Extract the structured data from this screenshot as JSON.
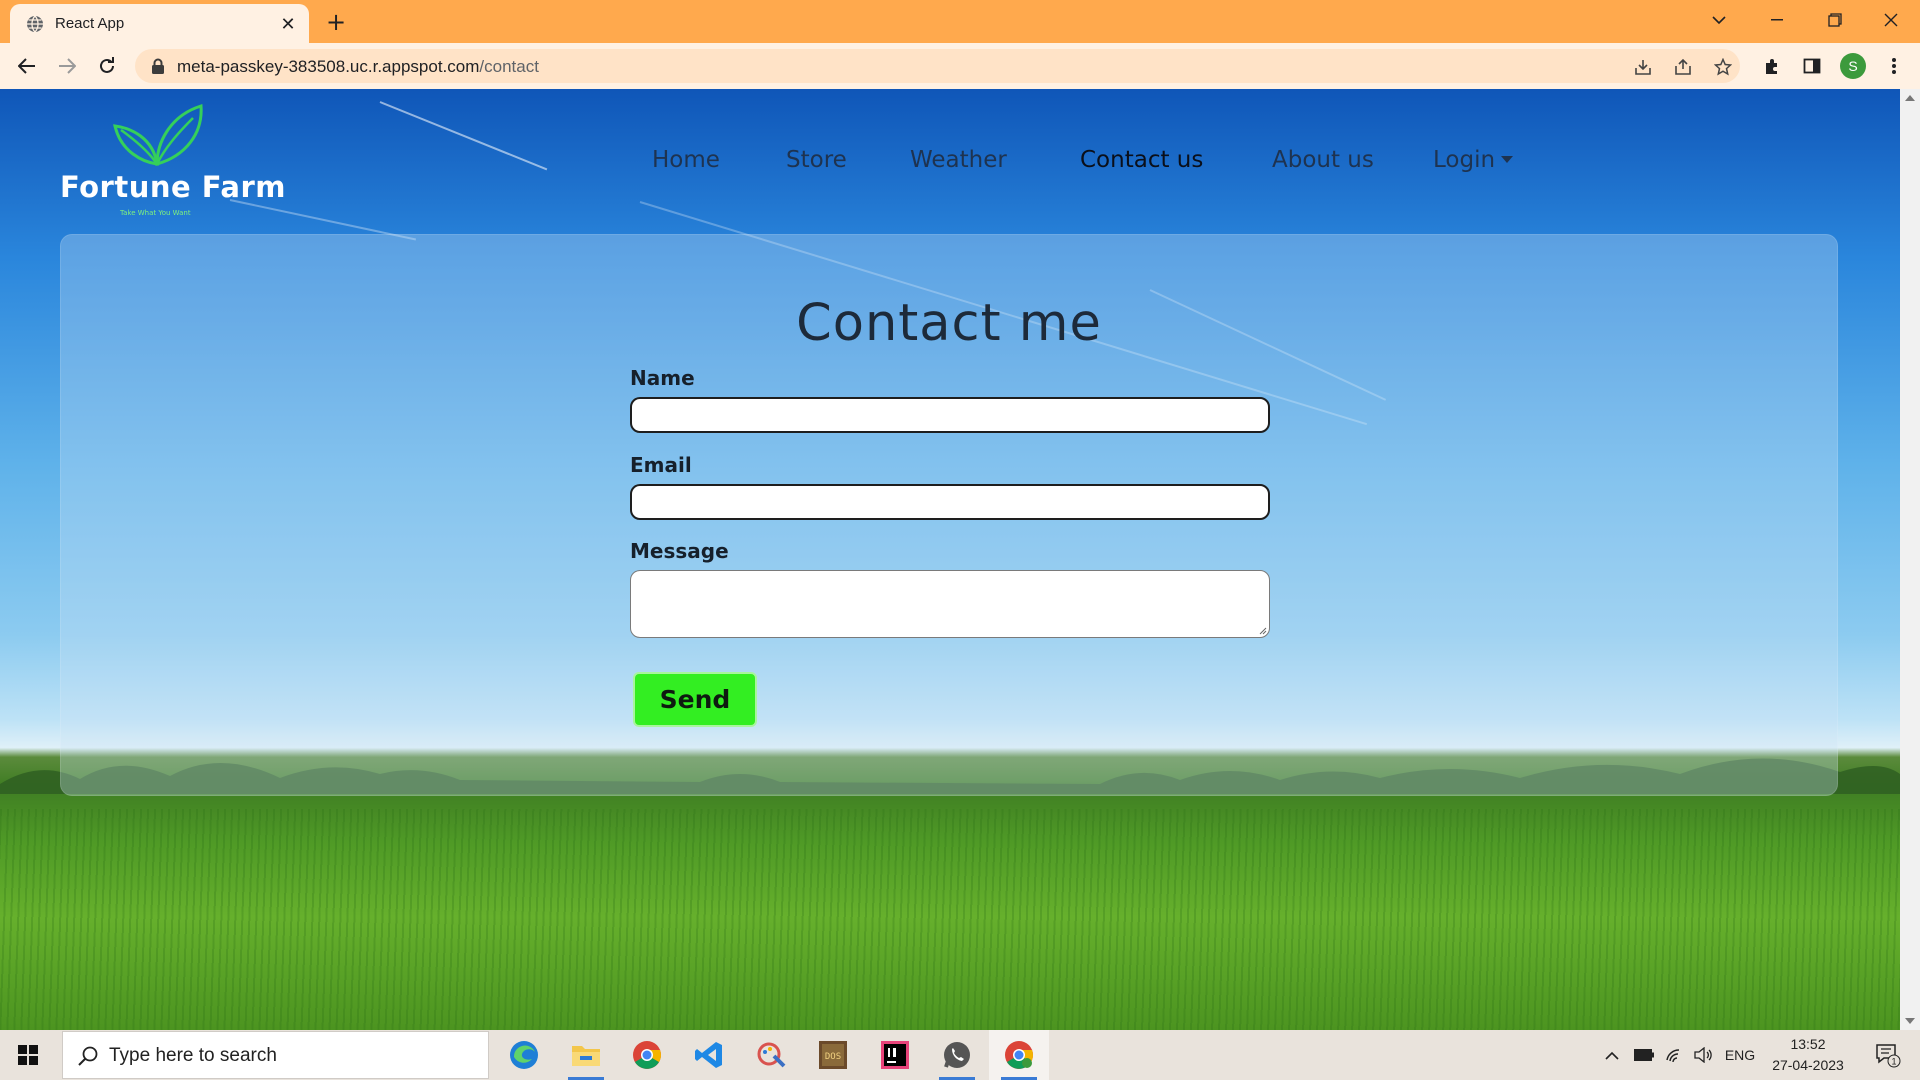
{
  "browser": {
    "tab_title": "React App",
    "url_host": "meta-passkey-383508.uc.r.appspot.com",
    "url_path": "/contact",
    "profile_initial": "S",
    "theme_color": "#ffa94d"
  },
  "site": {
    "brand": "Fortune Farm",
    "tagline": "Take What You Want",
    "nav": [
      {
        "label": "Home"
      },
      {
        "label": "Store"
      },
      {
        "label": "Weather"
      },
      {
        "label": "Contact us",
        "active": true
      },
      {
        "label": "About us"
      },
      {
        "label": "Login",
        "dropdown": true
      }
    ]
  },
  "form": {
    "heading": "Contact me",
    "name_label": "Name",
    "name_value": "",
    "email_label": "Email",
    "email_value": "",
    "message_label": "Message",
    "message_value": "",
    "send_label": "Send",
    "send_color": "#33ee22"
  },
  "taskbar": {
    "search_placeholder": "Type here to search",
    "apps": [
      "edge-icon",
      "file-explorer-icon",
      "chrome-icon",
      "vscode-icon",
      "paint-icon",
      "dosbox-icon",
      "intellij-icon",
      "whatsapp-icon",
      "chrome-profile-icon"
    ],
    "language": "ENG",
    "time": "13:52",
    "date": "27-04-2023",
    "notification_count": "1"
  }
}
